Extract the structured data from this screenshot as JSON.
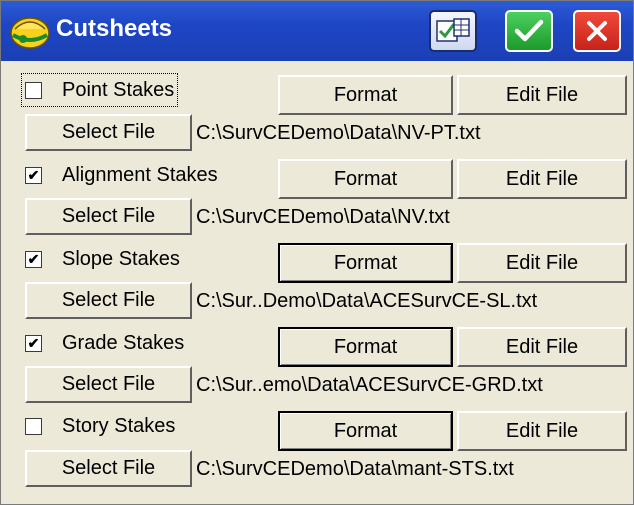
{
  "window": {
    "title": "Cutsheets",
    "icons": {
      "logo": "surveyor-hat-icon",
      "config": "grid-settings-icon",
      "ok": "check-icon",
      "close": "close-icon"
    },
    "colors": {
      "titlebar": "#1e46c4",
      "ok": "#22a53b",
      "close": "#d8281e",
      "body": "#ece9d8"
    }
  },
  "stakes": [
    {
      "label": "Point Stakes",
      "checked": false,
      "check_mark": "",
      "format_label": "Format",
      "edit_label": "Edit File",
      "select_label": "Select File",
      "path": "C:\\SurvCEDemo\\Data\\NV-PT.txt"
    },
    {
      "label": "Alignment Stakes",
      "checked": true,
      "check_mark": "✔",
      "format_label": "Format",
      "edit_label": "Edit File",
      "select_label": "Select File",
      "path": "C:\\SurvCEDemo\\Data\\NV.txt"
    },
    {
      "label": "Slope Stakes",
      "checked": true,
      "check_mark": "✔",
      "format_label": "Format",
      "edit_label": "Edit File",
      "select_label": "Select File",
      "path": "C:\\Sur..Demo\\Data\\ACESurvCE-SL.txt"
    },
    {
      "label": "Grade Stakes",
      "checked": true,
      "check_mark": "✔",
      "format_label": "Format",
      "edit_label": "Edit File",
      "select_label": "Select File",
      "path": "C:\\Sur..emo\\Data\\ACESurvCE-GRD.txt"
    },
    {
      "label": "Story Stakes",
      "checked": false,
      "check_mark": "",
      "format_label": "Format",
      "edit_label": "Edit File",
      "select_label": "Select File",
      "path": "C:\\SurvCEDemo\\Data\\mant-STS.txt"
    }
  ]
}
